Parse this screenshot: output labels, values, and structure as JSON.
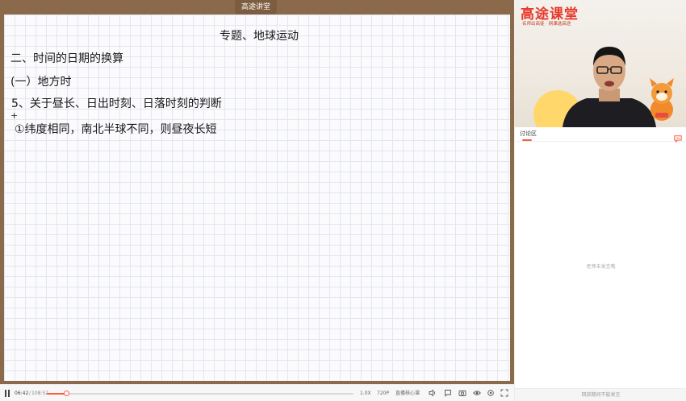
{
  "board": {
    "title_tab": "高途讲堂",
    "heading": "专题、地球运动",
    "lines": [
      "二、时间的日期的换算",
      "(一）地方时",
      "5、关于昼长、日出时刻、日落时刻的判断",
      "①纬度相同，南北半球不同，则昼夜长短"
    ],
    "cursor_mark": "+"
  },
  "player": {
    "current_time": "06:42",
    "separator": "/",
    "total_time": "108:52",
    "progress": 0.062,
    "speed": "1.0X",
    "quality": "720P",
    "core_label": "直播核心课"
  },
  "webcam": {
    "logo_title": "高途课堂",
    "logo_slogan": "名师出高徒 · 网课选高途"
  },
  "chat": {
    "title": "讨论区",
    "empty_text": "老师未发言哦",
    "footer_text": "回放期间不能发言"
  },
  "colors": {
    "accent": "#ff5a3c",
    "board_frame": "#8a6a4a",
    "logo_red": "#e8392b"
  },
  "icons": {
    "play": "play-pause-icon",
    "volume": "volume-icon",
    "bullet": "bullet-comment-icon",
    "screenshot": "screenshot-icon",
    "eye": "eye-icon",
    "settings": "settings-icon",
    "fullscreen": "fullscreen-icon",
    "chat": "chat-bubble-icon"
  }
}
